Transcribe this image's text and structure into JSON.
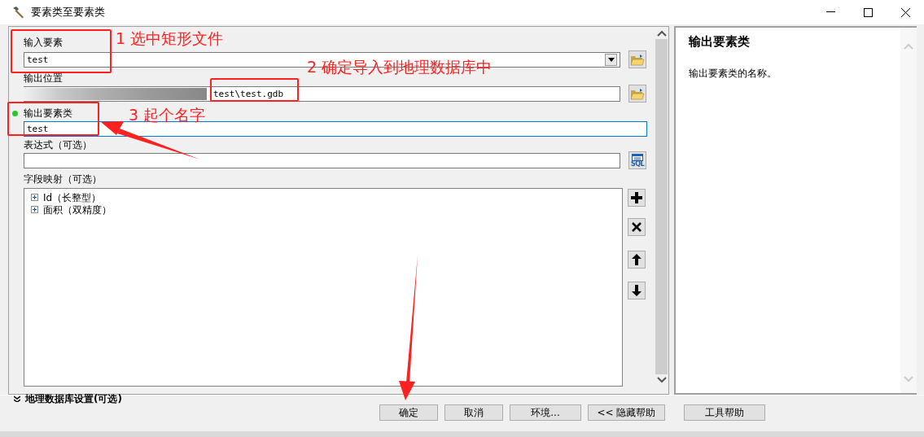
{
  "window": {
    "title": "要素类至要素类"
  },
  "form": {
    "fields": [
      {
        "kind": "combo",
        "label": "输入要素",
        "value": "test",
        "required": false,
        "focused": false,
        "button": {
          "kind": "folder"
        }
      },
      {
        "kind": "path",
        "label": "输出位置",
        "value": "test\\test.gdb",
        "required": false,
        "focused": false,
        "button": {
          "kind": "folder"
        }
      },
      {
        "kind": "text",
        "label": "输出要素类",
        "value": "test",
        "required": true,
        "focused": true
      },
      {
        "kind": "text",
        "label": "表达式（可选）",
        "required": false,
        "focused": false,
        "button": {
          "kind": "sql",
          "label": "SQL"
        }
      }
    ],
    "field_mapping": {
      "label": "字段映射（可选）",
      "items": [
        {
          "label": "Id（长整型）",
          "expanded": false
        },
        {
          "label": "面积（双精度）",
          "expanded": false
        }
      ]
    },
    "section": {
      "label": "地理数据库设置(可选)",
      "expanded": false
    }
  },
  "help": {
    "title": "输出要素类",
    "text": "输出要素类的名称。"
  },
  "buttons": [
    {
      "label": "确定"
    },
    {
      "label": "取消"
    },
    {
      "label": "环境..."
    },
    {
      "label": "<< 隐藏帮助"
    },
    {
      "label": "工具帮助"
    }
  ],
  "annotations": [
    {
      "text": "1 选中矩形文件"
    },
    {
      "text": "2 确定导入到地理数据库中"
    },
    {
      "text": "3 起个名字"
    }
  ]
}
